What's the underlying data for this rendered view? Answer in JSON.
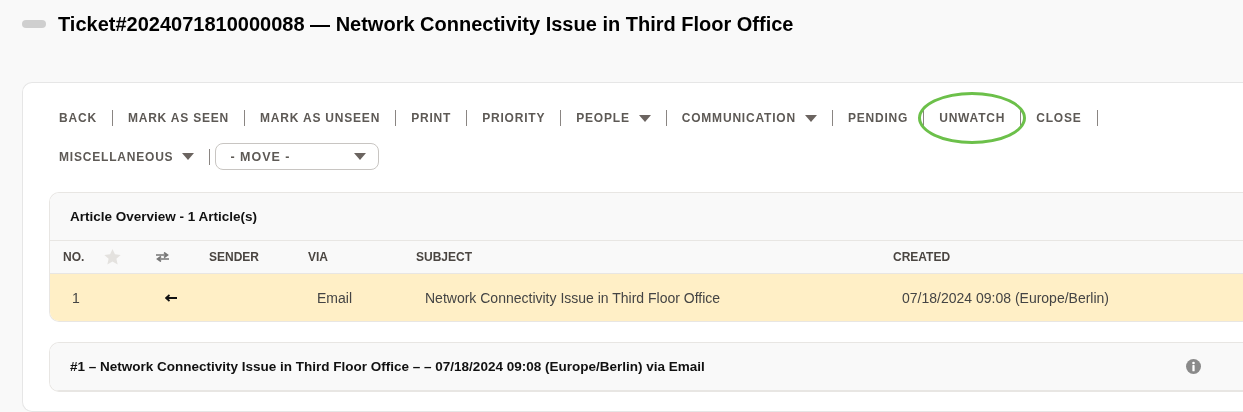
{
  "title": "Ticket#2024071810000088 — Network Connectivity Issue in Third Floor Office",
  "toolbar": {
    "items": [
      {
        "label": "BACK",
        "kind": "button",
        "highlighted": false
      },
      {
        "label": "MARK AS SEEN",
        "kind": "button",
        "highlighted": false
      },
      {
        "label": "MARK AS UNSEEN",
        "kind": "button",
        "highlighted": false
      },
      {
        "label": "PRINT",
        "kind": "button",
        "highlighted": false
      },
      {
        "label": "PRIORITY",
        "kind": "button",
        "highlighted": false
      },
      {
        "label": "PEOPLE",
        "kind": "dropdown",
        "highlighted": false
      },
      {
        "label": "COMMUNICATION",
        "kind": "dropdown",
        "highlighted": false
      },
      {
        "label": "PENDING",
        "kind": "button",
        "highlighted": false
      },
      {
        "label": "UNWATCH",
        "kind": "button",
        "highlighted": true
      },
      {
        "label": "CLOSE",
        "kind": "button",
        "highlighted": false
      },
      {
        "label": "MISCELLANEOUS",
        "kind": "dropdown",
        "highlighted": false
      },
      {
        "label": "- MOVE -",
        "kind": "select",
        "highlighted": false
      }
    ]
  },
  "article_overview": {
    "title": "Article Overview - 1 Article(s)",
    "columns": [
      {
        "kind": "text",
        "label": "NO."
      },
      {
        "kind": "star"
      },
      {
        "kind": "swap"
      },
      {
        "kind": "text",
        "label": "SENDER"
      },
      {
        "kind": "text",
        "label": "VIA"
      },
      {
        "kind": "text",
        "label": "SUBJECT"
      },
      {
        "kind": "text",
        "label": "CREATED"
      }
    ],
    "rows": [
      {
        "no": "1",
        "via": "Email",
        "subject": "Network Connectivity Issue in Third Floor Office",
        "created": "07/18/2024 09:08 (Europe/Berlin)",
        "selected": true
      }
    ]
  },
  "article": {
    "title": "#1 – Network Connectivity Issue in Third Floor Office – – 07/18/2024 09:08 (Europe/Berlin) via Email"
  }
}
